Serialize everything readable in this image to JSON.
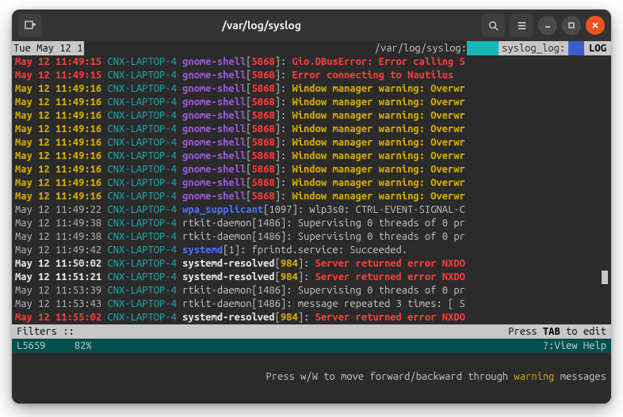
{
  "window": {
    "title": "/var/log/syslog"
  },
  "statusbar": {
    "date": "Tue May 12 1",
    "path": "/var/log/syslog:",
    "panel": "syslog_log:",
    "mode": "LOG"
  },
  "lines": [
    {
      "dateClass": "date-red",
      "date": "May 12 11:49:15",
      "host": "CNX-LAPTOP-4",
      "proc": "gnome-shell",
      "procClass": "proc-purple",
      "pid": "5868",
      "pidClass": "pid-red",
      "msg": " Gio.DBusError: Error calling S",
      "msgClass": "msg-red"
    },
    {
      "dateClass": "date-red",
      "date": "May 12 11:49:15",
      "host": "CNX-LAPTOP-4",
      "proc": "gnome-shell",
      "procClass": "proc-purple",
      "pid": "5868",
      "pidClass": "pid-red",
      "msg": " Error connecting to Nautilus",
      "msgClass": "msg-red"
    },
    {
      "dateClass": "date-yel",
      "date": "May 12 11:49:16",
      "host": "CNX-LAPTOP-4",
      "proc": "gnome-shell",
      "procClass": "proc-purple",
      "pid": "5868",
      "pidClass": "pid-red",
      "msg": " Window manager warning: Overwr",
      "msgClass": "msg-yel"
    },
    {
      "dateClass": "date-yel",
      "date": "May 12 11:49:16",
      "host": "CNX-LAPTOP-4",
      "proc": "gnome-shell",
      "procClass": "proc-purple",
      "pid": "5868",
      "pidClass": "pid-red",
      "msg": " Window manager warning: Overwr",
      "msgClass": "msg-yel"
    },
    {
      "dateClass": "date-yel",
      "date": "May 12 11:49:16",
      "host": "CNX-LAPTOP-4",
      "proc": "gnome-shell",
      "procClass": "proc-purple",
      "pid": "5868",
      "pidClass": "pid-red",
      "msg": " Window manager warning: Overwr",
      "msgClass": "msg-yel"
    },
    {
      "dateClass": "date-yel",
      "date": "May 12 11:49:16",
      "host": "CNX-LAPTOP-4",
      "proc": "gnome-shell",
      "procClass": "proc-purple",
      "pid": "5868",
      "pidClass": "pid-red",
      "msg": " Window manager warning: Overwr",
      "msgClass": "msg-yel"
    },
    {
      "dateClass": "date-yel",
      "date": "May 12 11:49:16",
      "host": "CNX-LAPTOP-4",
      "proc": "gnome-shell",
      "procClass": "proc-purple",
      "pid": "5868",
      "pidClass": "pid-red",
      "msg": " Window manager warning: Overwr",
      "msgClass": "msg-yel"
    },
    {
      "dateClass": "date-yel",
      "date": "May 12 11:49:16",
      "host": "CNX-LAPTOP-4",
      "proc": "gnome-shell",
      "procClass": "proc-purple",
      "pid": "5868",
      "pidClass": "pid-red",
      "msg": " Window manager warning: Overwr",
      "msgClass": "msg-yel"
    },
    {
      "dateClass": "date-yel",
      "date": "May 12 11:49:16",
      "host": "CNX-LAPTOP-4",
      "proc": "gnome-shell",
      "procClass": "proc-purple",
      "pid": "5868",
      "pidClass": "pid-red",
      "msg": " Window manager warning: Overwr",
      "msgClass": "msg-yel"
    },
    {
      "dateClass": "date-yel",
      "date": "May 12 11:49:16",
      "host": "CNX-LAPTOP-4",
      "proc": "gnome-shell",
      "procClass": "proc-purple",
      "pid": "5868",
      "pidClass": "pid-red",
      "msg": " Window manager warning: Overwr",
      "msgClass": "msg-yel"
    },
    {
      "dateClass": "date-yel",
      "date": "May 12 11:49:16",
      "host": "CNX-LAPTOP-4",
      "proc": "gnome-shell",
      "procClass": "proc-purple",
      "pid": "5868",
      "pidClass": "pid-red",
      "msg": " Window manager warning: Overwr",
      "msgClass": "msg-yel"
    },
    {
      "dateClass": "date-gray",
      "date": "May 12 11:49:22",
      "host": "CNX-LAPTOP-4",
      "proc": "wpa_supplicant",
      "procClass": "proc-blue",
      "pid": "1097",
      "pidClass": "pid-gray",
      "msg": " wlp3s0: CTRL-EVENT-SIGNAL-C",
      "msgClass": "msg-gray"
    },
    {
      "dateClass": "date-gray",
      "date": "May 12 11:49:38",
      "host": "CNX-LAPTOP-4",
      "proc": "rtkit-daemon",
      "procClass": "proc-gray",
      "pid": "1486",
      "pidClass": "pid-gray",
      "msg": " Supervising 0 threads of 0 pr",
      "msgClass": "msg-gray"
    },
    {
      "dateClass": "date-gray",
      "date": "May 12 11:49:38",
      "host": "CNX-LAPTOP-4",
      "proc": "rtkit-daemon",
      "procClass": "proc-gray",
      "pid": "1486",
      "pidClass": "pid-gray",
      "msg": " Supervising 0 threads of 0 pr",
      "msgClass": "msg-gray"
    },
    {
      "dateClass": "date-gray",
      "date": "May 12 11:49:42",
      "host": "CNX-LAPTOP-4",
      "proc": "systemd",
      "procClass": "proc-blue",
      "pid": "1",
      "pidClass": "pid-gray",
      "msg": " fprintd.service: Succeeded.",
      "msgClass": "msg-gray"
    },
    {
      "dateClass": "date-bold",
      "date": "May 12 11:50:02",
      "host": "CNX-LAPTOP-4",
      "proc": "systemd-resolved",
      "procClass": "proc-white",
      "pid": "984",
      "pidClass": "pid-yel",
      "msg": " Server returned error NXDO",
      "msgClass": "msg-red"
    },
    {
      "dateClass": "date-bold",
      "date": "May 12 11:51:21",
      "host": "CNX-LAPTOP-4",
      "proc": "systemd-resolved",
      "procClass": "proc-white",
      "pid": "984",
      "pidClass": "pid-yel",
      "msg": " Server returned error NXDO",
      "msgClass": "msg-red",
      "hl": true
    },
    {
      "dateClass": "date-gray",
      "date": "May 12 11:53:39",
      "host": "CNX-LAPTOP-4",
      "proc": "rtkit-daemon",
      "procClass": "proc-gray",
      "pid": "1486",
      "pidClass": "pid-gray",
      "msg": " Supervising 0 threads of 0 pr",
      "msgClass": "msg-gray"
    },
    {
      "dateClass": "date-gray",
      "date": "May 12 11:53:43",
      "host": "CNX-LAPTOP-4",
      "proc": "rtkit-daemon",
      "procClass": "proc-gray",
      "pid": "1486",
      "pidClass": "pid-gray",
      "msg": " message repeated 3 times: [ S",
      "msgClass": "msg-gray"
    },
    {
      "dateClass": "date-red",
      "date": "May 12 11:55:02",
      "host": "CNX-LAPTOP-4",
      "proc": "systemd-resolved",
      "procClass": "proc-white",
      "pid": "984",
      "pidClass": "pid-yel",
      "msg": " Server returned error NXDO",
      "msgClass": "msg-red"
    }
  ],
  "filters": {
    "left": "Filters ::",
    "right_pre": "Press ",
    "right_key": "TAB",
    "right_post": " to edit"
  },
  "bottom1": {
    "left_line": "L5659",
    "left_pct": "82%",
    "right": "?:View Help"
  },
  "bottom2": {
    "pre": "Press w/W to move forward/backward through ",
    "kw": "warning",
    "post": " messages"
  }
}
